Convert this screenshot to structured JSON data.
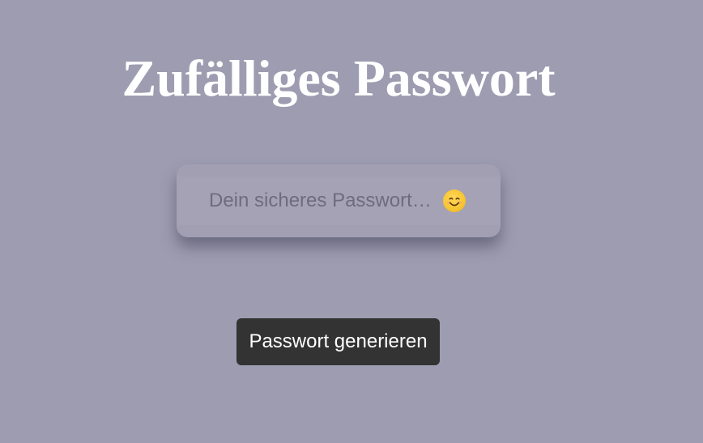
{
  "header": {
    "title": "Zufälliges Passwort"
  },
  "password_field": {
    "placeholder": "Dein sicheres Passwort…",
    "value": "",
    "copy_icon": "smiling-face-emoji"
  },
  "actions": {
    "generate_label": "Passwort generieren"
  },
  "colors": {
    "background": "#9e9cb0",
    "title_text": "#ffffff",
    "field_background": "#a29fb3",
    "button_background": "#333333",
    "button_text": "#ffffff",
    "emoji": "#f7c531"
  }
}
